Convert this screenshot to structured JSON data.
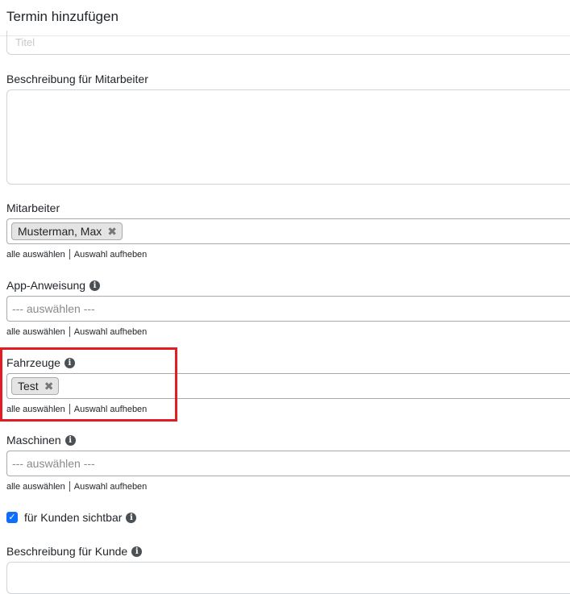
{
  "header": {
    "title": "Termin hinzufügen"
  },
  "title_field": {
    "placeholder": "Titel"
  },
  "employee_description": {
    "label": "Beschreibung für Mitarbeiter",
    "value": ""
  },
  "employees": {
    "label": "Mitarbeiter",
    "selected": [
      "Musterman, Max"
    ],
    "select_all": "alle auswählen",
    "clear": "Auswahl aufheben"
  },
  "app_instruction": {
    "label": "App-Anweisung",
    "placeholder": "--- auswählen ---",
    "select_all": "alle auswählen",
    "clear": "Auswahl aufheben"
  },
  "vehicles": {
    "label": "Fahrzeuge",
    "selected": [
      "Test"
    ],
    "select_all": "alle auswählen",
    "clear": "Auswahl aufheben"
  },
  "machines": {
    "label": "Maschinen",
    "placeholder": "--- auswählen ---",
    "select_all": "alle auswählen",
    "clear": "Auswahl aufheben"
  },
  "customer_visible": {
    "label": "für Kunden sichtbar",
    "checked": true
  },
  "customer_description": {
    "label": "Beschreibung für Kunde",
    "value": ""
  },
  "icons": {
    "info": "info-icon",
    "remove": "close-icon",
    "check": "checkmark-icon"
  },
  "colors": {
    "highlight": "#e31b23",
    "checkbox": "#0d6efd",
    "chip_bg": "#e4e4e4"
  }
}
